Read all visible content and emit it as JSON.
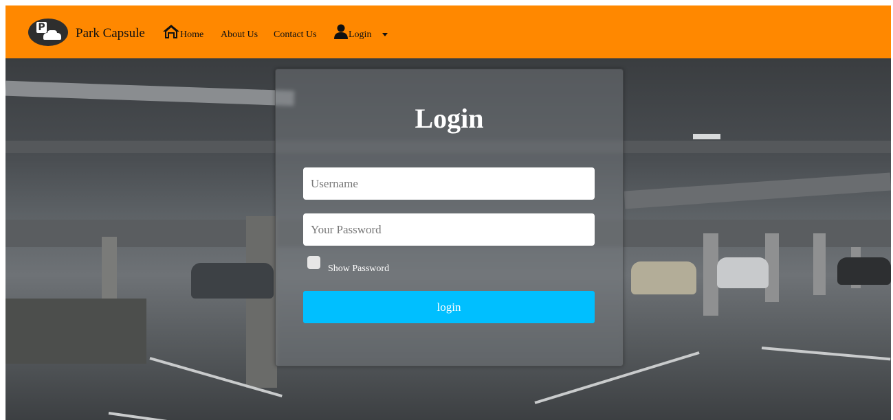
{
  "brand": {
    "name": "Park Capsule",
    "logo_icon": "parking-car-icon"
  },
  "nav": {
    "home": "Home",
    "about": "About Us",
    "contact": "Contact Us",
    "login": "Login"
  },
  "form": {
    "title": "Login",
    "username_placeholder": "Username",
    "password_placeholder": "Your Password",
    "show_password_label": "Show Password",
    "submit_label": "login",
    "show_password_checked": false
  },
  "colors": {
    "navbar": "#ff8800",
    "button": "#00bfff"
  }
}
